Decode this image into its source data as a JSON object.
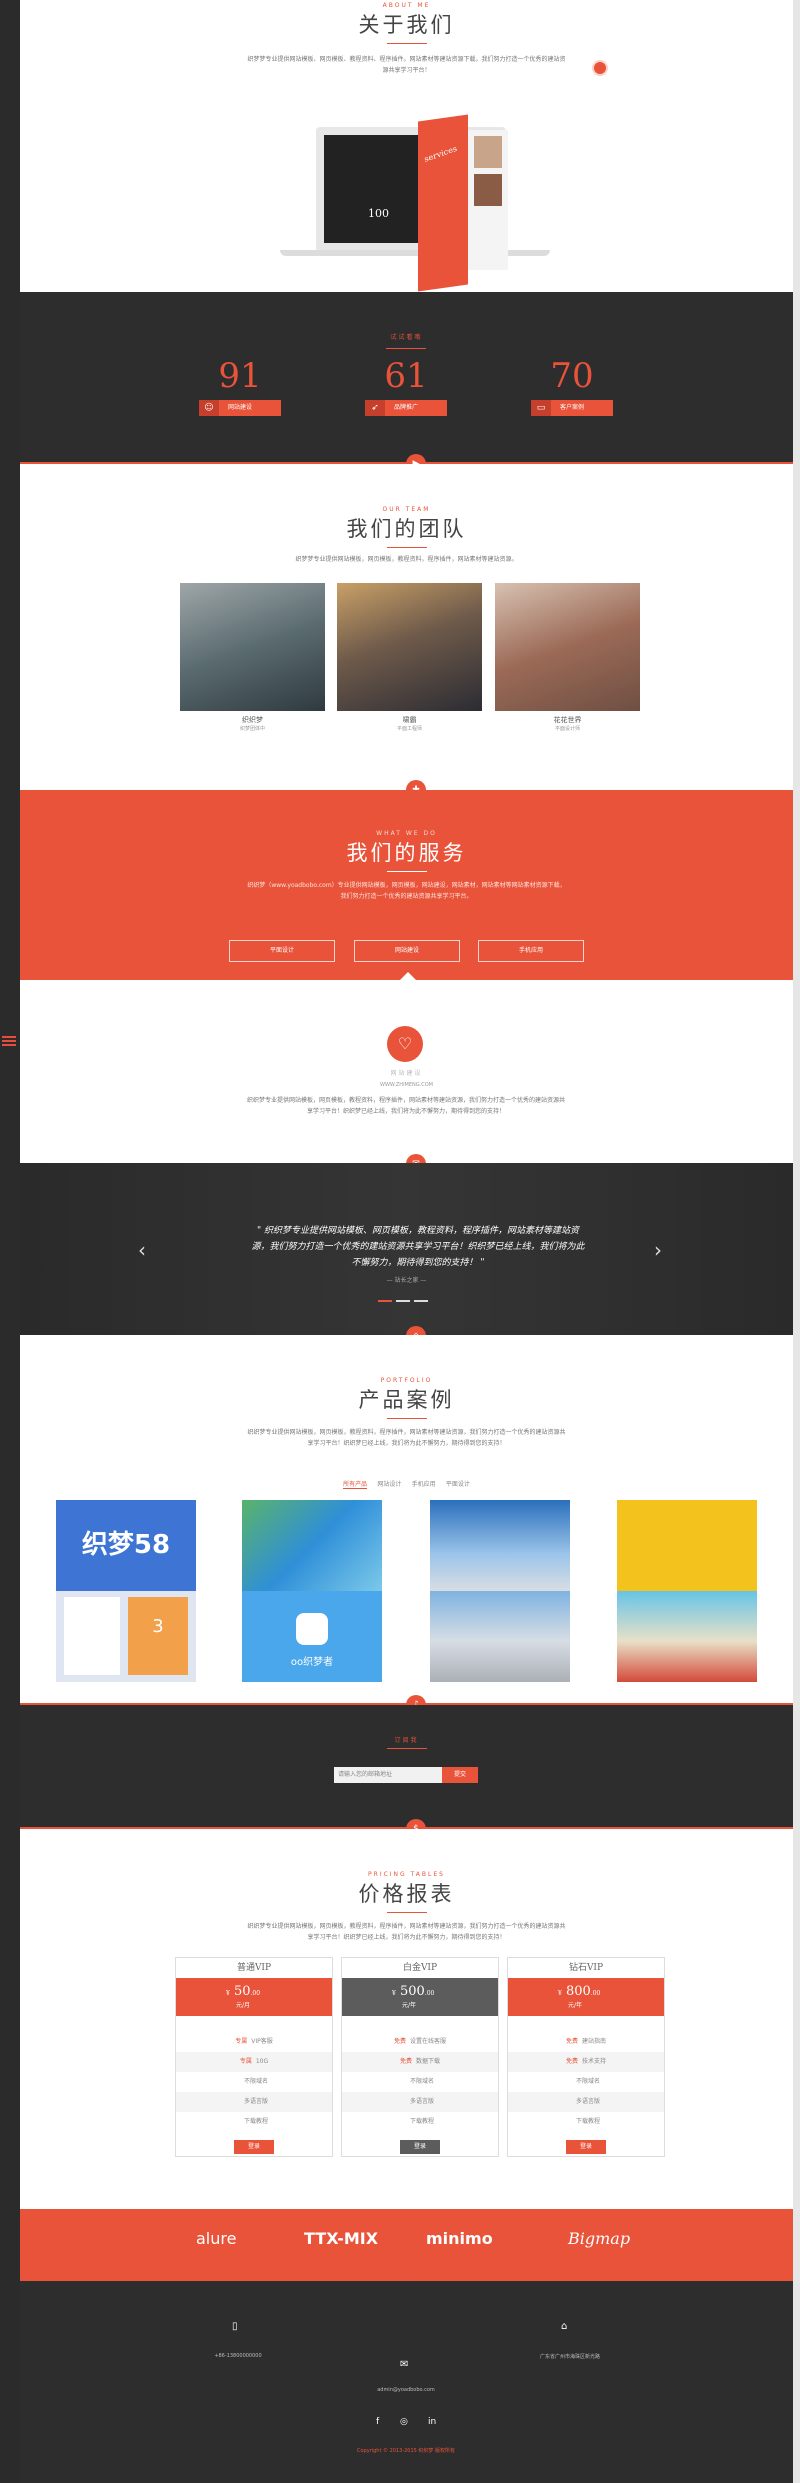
{
  "about": {
    "sub": "ABOUT ME",
    "title": "关于我们",
    "desc": "织梦梦专业提供网站模板、网页模板、教程资料、程序插件。网站素材等建站资源下载，我们努力打造一个优秀的建站资源共享学习平台！",
    "screen_big": "100",
    "book_title": "services"
  },
  "stats": {
    "sub": "试试看哦",
    "items": [
      {
        "num": "91",
        "label": "网站建设",
        "icon": "cat-icon"
      },
      {
        "num": "61",
        "label": "品牌推广",
        "icon": "rocket-icon"
      },
      {
        "num": "70",
        "label": "客户案例",
        "icon": "laptop-icon"
      }
    ]
  },
  "team": {
    "sub": "OUR TEAM",
    "title": "我们的团队",
    "desc": "织梦梦专业提供网站模板，网页模板，教程资料，程序插件，网站素材等建站资源。",
    "members": [
      {
        "name": "织织梦",
        "role": "织梦团体中"
      },
      {
        "name": "啸霸",
        "role": "平面工程师"
      },
      {
        "name": "花花世界",
        "role": "平面设计师"
      }
    ]
  },
  "services": {
    "sub": "WHAT WE DO",
    "title": "我们的服务",
    "desc": "织织梦（www.yoadbobo.com）专业提供网站模板，网页模板，网站建设，网站素材，网站素材等网站素材资源下载，我们努力打造一个优秀的建站资源共享学习平台。",
    "buttons": [
      "平面设计",
      "网站建设",
      "手机应用"
    ]
  },
  "web": {
    "title": "网站建设",
    "link": "WWW.ZHIMENG.COM",
    "desc": "织织梦专业提供网站模板，网页模板，教程资料，程序插件，网站素材等建站资源，我们努力打造一个优秀的建站资源共享学习平台！织织梦已经上线，我们将为此不懈努力，期待得到您的支持！"
  },
  "testimonial": {
    "quote": "\" 织织梦专业提供网站模板、网页模板，教程资料，程序插件，网站素材等建站资源，我们努力打造一个优秀的建站资源共享学习平台！织织梦已经上线，我们将为此不懈努力，期待得到您的支持！ \"",
    "author": "— 站长之家 —"
  },
  "portfolio": {
    "sub": "PORTFOLIO",
    "title": "产品案例",
    "desc": "织织梦专业提供网站模板，网页模板，教程资料，程序插件，网站素材等建站资源，我们努力打造一个优秀的建站资源共享学习平台！织织梦已经上线，我们将为此不懈努力，期待得到您的支持！",
    "tabs": [
      "所有产品",
      "网站设计",
      "手机应用",
      "平面设计"
    ],
    "case1_logo": "织梦58",
    "case2_logo": "oo织梦者",
    "case1_badge": "3"
  },
  "subscribe": {
    "sub": "订阅我",
    "placeholder": "请输入您的邮箱地址",
    "button": "提交"
  },
  "pricing": {
    "sub": "PRICING TABLES",
    "title": "价格报表",
    "desc": "织织梦专业提供网站模板，网页模板，教程资料，程序插件，网站素材等建站资源，我们努力打造一个优秀的建站资源共享学习平台！织织梦已经上线，我们将为此不懈努力，期待得到您的支持！",
    "plans": [
      {
        "name": "普通VIP",
        "cur": "¥",
        "price": "50",
        "cents": ".00",
        "per": "元/月",
        "color": "#e8533a",
        "features": [
          [
            "专属",
            "VIP客服"
          ],
          [
            "专属",
            "10G"
          ],
          [
            "",
            "不限域名"
          ],
          [
            "",
            "多语言版"
          ],
          [
            "",
            "下载教程"
          ]
        ],
        "buy": "登录"
      },
      {
        "name": "白金VIP",
        "cur": "¥",
        "price": "500",
        "cents": ".00",
        "per": "元/年",
        "color": "#5c5c5c",
        "features": [
          [
            "免费",
            "设置在线客服"
          ],
          [
            "免费",
            "数据下载"
          ],
          [
            "",
            "不限域名"
          ],
          [
            "",
            "多语言版"
          ],
          [
            "",
            "下载教程"
          ]
        ],
        "buy": "登录"
      },
      {
        "name": "钻石VIP",
        "cur": "¥",
        "price": "800",
        "cents": ".00",
        "per": "元/年",
        "color": "#e8533a",
        "features": [
          [
            "免费",
            "建站指南"
          ],
          [
            "免费",
            "技术支持"
          ],
          [
            "",
            "不限域名"
          ],
          [
            "",
            "多语言版"
          ],
          [
            "",
            "下载教程"
          ]
        ],
        "buy": "登录"
      }
    ]
  },
  "brands": [
    "alure",
    "TTX-MIX",
    "minimo",
    "Bigmap"
  ],
  "footer": {
    "phone": "+86-13800000000",
    "email": "admin@yoadbobo.com",
    "address": "广东省广州市海珠区新光路",
    "copyright": "Copyright © 2013-2015 织织梦 版权所有"
  },
  "colors": {
    "accent": "#e8533a",
    "dark": "#2d2d2d"
  }
}
